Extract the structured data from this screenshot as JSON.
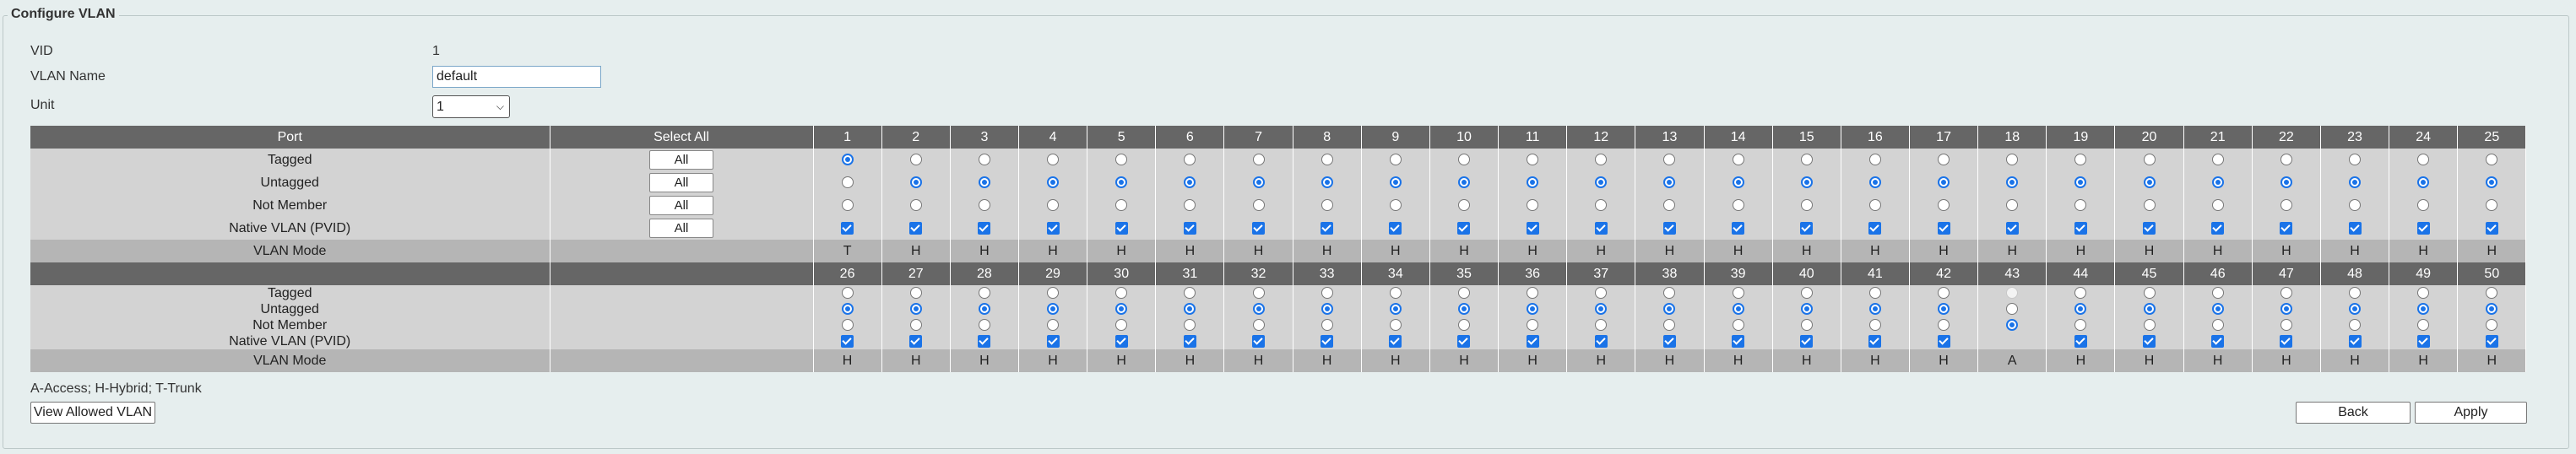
{
  "title": "Configure VLAN",
  "vid": {
    "label": "VID",
    "value": "1"
  },
  "vlan_name": {
    "label": "VLAN Name",
    "value": "default"
  },
  "unit": {
    "label": "Unit",
    "value": "1"
  },
  "table": {
    "port_header": "Port",
    "select_all_header": "Select All",
    "all_label": "All",
    "row_labels": [
      "Tagged",
      "Untagged",
      "Not Member",
      "Native VLAN (PVID)"
    ],
    "mode_label": "VLAN Mode",
    "ports": [
      {
        "num": "1",
        "state": "tagged",
        "native": true,
        "mode": "T"
      },
      {
        "num": "2",
        "state": "untagged",
        "native": true,
        "mode": "H"
      },
      {
        "num": "3",
        "state": "untagged",
        "native": true,
        "mode": "H"
      },
      {
        "num": "4",
        "state": "untagged",
        "native": true,
        "mode": "H"
      },
      {
        "num": "5",
        "state": "untagged",
        "native": true,
        "mode": "H"
      },
      {
        "num": "6",
        "state": "untagged",
        "native": true,
        "mode": "H"
      },
      {
        "num": "7",
        "state": "untagged",
        "native": true,
        "mode": "H"
      },
      {
        "num": "8",
        "state": "untagged",
        "native": true,
        "mode": "H"
      },
      {
        "num": "9",
        "state": "untagged",
        "native": true,
        "mode": "H"
      },
      {
        "num": "10",
        "state": "untagged",
        "native": true,
        "mode": "H"
      },
      {
        "num": "11",
        "state": "untagged",
        "native": true,
        "mode": "H"
      },
      {
        "num": "12",
        "state": "untagged",
        "native": true,
        "mode": "H"
      },
      {
        "num": "13",
        "state": "untagged",
        "native": true,
        "mode": "H"
      },
      {
        "num": "14",
        "state": "untagged",
        "native": true,
        "mode": "H"
      },
      {
        "num": "15",
        "state": "untagged",
        "native": true,
        "mode": "H"
      },
      {
        "num": "16",
        "state": "untagged",
        "native": true,
        "mode": "H"
      },
      {
        "num": "17",
        "state": "untagged",
        "native": true,
        "mode": "H"
      },
      {
        "num": "18",
        "state": "untagged",
        "native": true,
        "mode": "H"
      },
      {
        "num": "19",
        "state": "untagged",
        "native": true,
        "mode": "H"
      },
      {
        "num": "20",
        "state": "untagged",
        "native": true,
        "mode": "H"
      },
      {
        "num": "21",
        "state": "untagged",
        "native": true,
        "mode": "H"
      },
      {
        "num": "22",
        "state": "untagged",
        "native": true,
        "mode": "H"
      },
      {
        "num": "23",
        "state": "untagged",
        "native": true,
        "mode": "H"
      },
      {
        "num": "24",
        "state": "untagged",
        "native": true,
        "mode": "H"
      },
      {
        "num": "25",
        "state": "untagged",
        "native": true,
        "mode": "H"
      },
      {
        "num": "26",
        "state": "untagged",
        "native": true,
        "mode": "H"
      },
      {
        "num": "27",
        "state": "untagged",
        "native": true,
        "mode": "H"
      },
      {
        "num": "28",
        "state": "untagged",
        "native": true,
        "mode": "H"
      },
      {
        "num": "29",
        "state": "untagged",
        "native": true,
        "mode": "H"
      },
      {
        "num": "30",
        "state": "untagged",
        "native": true,
        "mode": "H"
      },
      {
        "num": "31",
        "state": "untagged",
        "native": true,
        "mode": "H"
      },
      {
        "num": "32",
        "state": "untagged",
        "native": true,
        "mode": "H"
      },
      {
        "num": "33",
        "state": "untagged",
        "native": true,
        "mode": "H"
      },
      {
        "num": "34",
        "state": "untagged",
        "native": true,
        "mode": "H"
      },
      {
        "num": "35",
        "state": "untagged",
        "native": true,
        "mode": "H"
      },
      {
        "num": "36",
        "state": "untagged",
        "native": true,
        "mode": "H"
      },
      {
        "num": "37",
        "state": "untagged",
        "native": true,
        "mode": "H"
      },
      {
        "num": "38",
        "state": "untagged",
        "native": true,
        "mode": "H"
      },
      {
        "num": "39",
        "state": "untagged",
        "native": true,
        "mode": "H"
      },
      {
        "num": "40",
        "state": "untagged",
        "native": true,
        "mode": "H"
      },
      {
        "num": "41",
        "state": "untagged",
        "native": true,
        "mode": "H"
      },
      {
        "num": "42",
        "state": "untagged",
        "native": true,
        "mode": "H"
      },
      {
        "num": "43",
        "state": "notmember",
        "native": false,
        "mode": "A"
      },
      {
        "num": "44",
        "state": "untagged",
        "native": true,
        "mode": "H"
      },
      {
        "num": "45",
        "state": "untagged",
        "native": true,
        "mode": "H"
      },
      {
        "num": "46",
        "state": "untagged",
        "native": true,
        "mode": "H"
      },
      {
        "num": "47",
        "state": "untagged",
        "native": true,
        "mode": "H"
      },
      {
        "num": "48",
        "state": "untagged",
        "native": true,
        "mode": "H"
      },
      {
        "num": "49",
        "state": "untagged",
        "native": true,
        "mode": "H"
      },
      {
        "num": "50",
        "state": "untagged",
        "native": true,
        "mode": "H"
      }
    ]
  },
  "mode_legend": "A-Access; H-Hybrid; T-Trunk",
  "buttons": {
    "view_allowed": "View Allowed VLAN",
    "back": "Back",
    "apply": "Apply"
  },
  "colors": {
    "accent": "#1a73e8",
    "header_bg": "#666666",
    "row_bg": "#d3d3d3",
    "mode_bg": "#b5b5b5"
  }
}
